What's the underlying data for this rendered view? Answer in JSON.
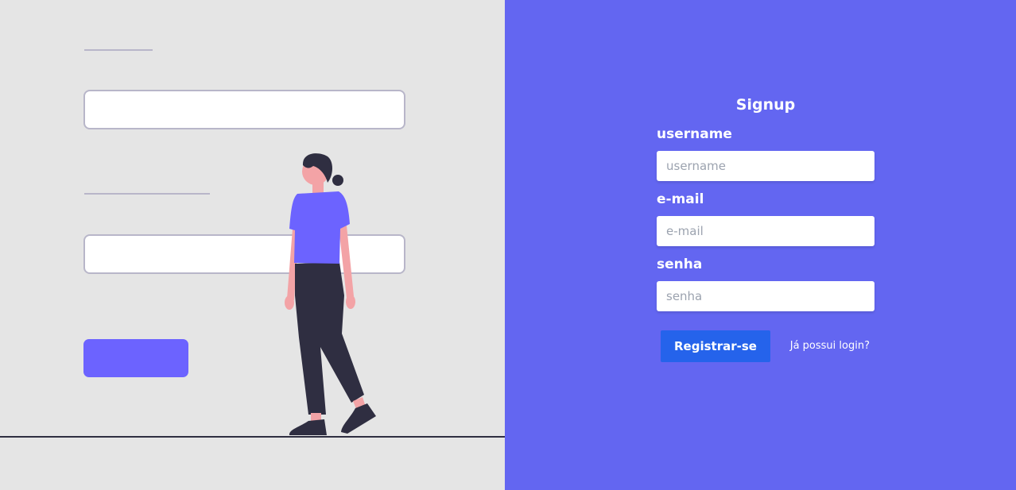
{
  "signup": {
    "title": "Signup",
    "fields": [
      {
        "label": "username",
        "placeholder": "username",
        "value": ""
      },
      {
        "label": "e-mail",
        "placeholder": "e-mail",
        "value": ""
      },
      {
        "label": "senha",
        "placeholder": "senha",
        "value": ""
      }
    ],
    "submit_label": "Registrar-se",
    "login_link_label": "Já possui login?"
  },
  "colors": {
    "left_background": "#e5e5e5",
    "right_background": "#6366f1",
    "submit_button": "#2563eb",
    "illustration_accent": "#6c63ff",
    "illustration_dark": "#2f2e41",
    "illustration_skin": "#f3a3a6"
  },
  "illustration": {
    "name": "woman-walking-by-form-illustration"
  }
}
